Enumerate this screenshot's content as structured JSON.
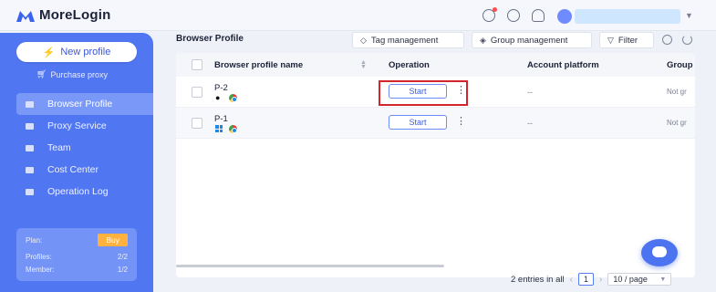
{
  "app": {
    "name": "MoreLogin",
    "brand_color": "#5176f2"
  },
  "topbar": {
    "icons": [
      "help-icon",
      "headset-icon",
      "bell-icon"
    ],
    "account_icon": "team-avatar-icon"
  },
  "sidebar": {
    "new_profile_label": "New profile",
    "purchase_label": "Purchase proxy",
    "items": [
      {
        "label": "Browser Profile",
        "icon": "browser-icon",
        "active": true
      },
      {
        "label": "Proxy Service",
        "icon": "proxy-icon"
      },
      {
        "label": "Team",
        "icon": "team-icon"
      },
      {
        "label": "Cost Center",
        "icon": "wallet-icon"
      },
      {
        "label": "Operation Log",
        "icon": "log-icon"
      }
    ],
    "plan": {
      "plan_label": "Plan:",
      "buy_label": "Buy",
      "profiles_label": "Profiles:",
      "profiles_value": "2/2",
      "member_label": "Member:",
      "member_value": "1/2"
    }
  },
  "main": {
    "title": "Browser Profile",
    "toolbar": {
      "tag_label": "Tag management",
      "group_label": "Group management",
      "filter_label": "Filter"
    },
    "table": {
      "columns": [
        "Browser profile name",
        "Operation",
        "Account platform",
        "Group"
      ],
      "rows": [
        {
          "name": "P-2",
          "os": "mac",
          "browser": "chrome",
          "operation": "Start",
          "account_platform": "--",
          "group": "Not gr"
        },
        {
          "name": "P-1",
          "os": "windows",
          "browser": "chrome",
          "operation": "Start",
          "account_platform": "--",
          "group": "Not gr"
        }
      ]
    },
    "pagination": {
      "total_text": "2 entries in all",
      "current_page": "1",
      "page_size": "10 / page"
    }
  }
}
